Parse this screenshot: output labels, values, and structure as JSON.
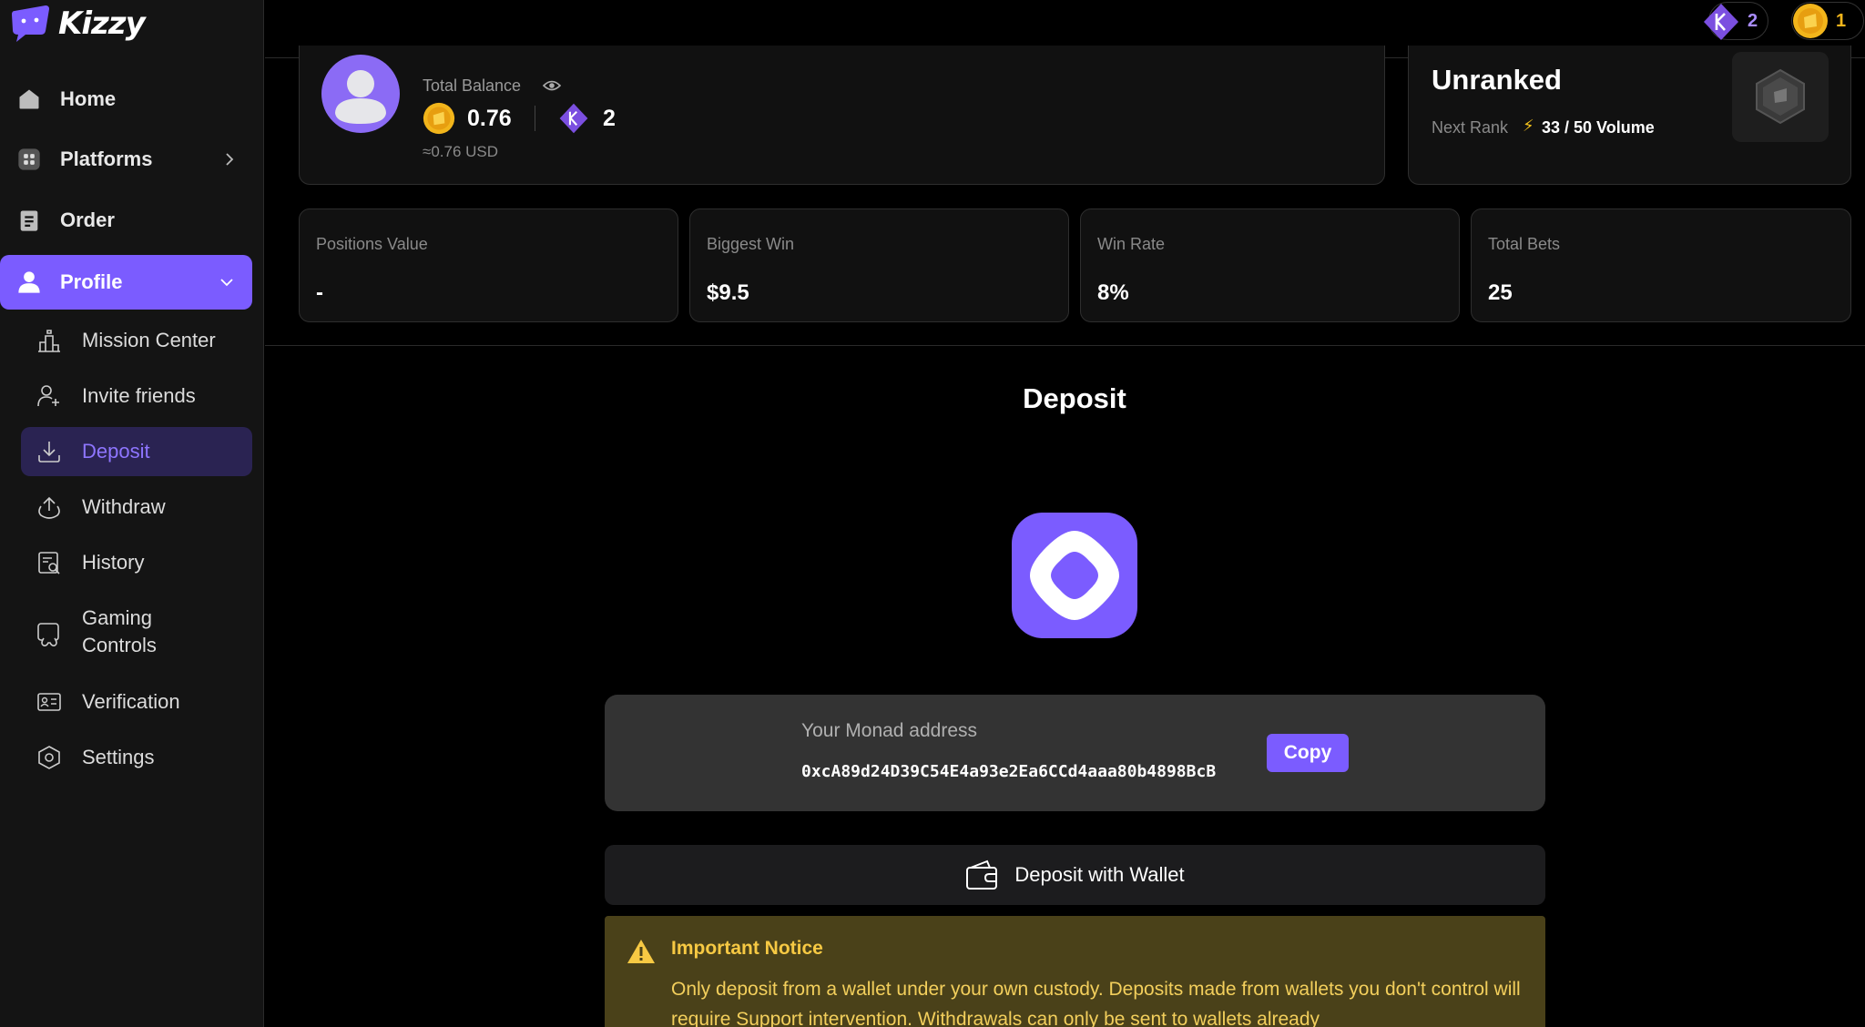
{
  "app": {
    "name": "Kizzy"
  },
  "topbar": {
    "k_count": "2",
    "coin_count": "1"
  },
  "sidebar": {
    "items": [
      {
        "label": "Home",
        "icon": "home-icon"
      },
      {
        "label": "Platforms",
        "icon": "grid-icon"
      },
      {
        "label": "Order",
        "icon": "clipboard-icon"
      },
      {
        "label": "Profile",
        "icon": "user-icon"
      }
    ],
    "sub_items": [
      {
        "label": "Mission Center",
        "icon": "podium-icon"
      },
      {
        "label": "Invite friends",
        "icon": "add-user-icon"
      },
      {
        "label": "Deposit",
        "icon": "download-icon"
      },
      {
        "label": "Withdraw",
        "icon": "upload-icon"
      },
      {
        "label": "History",
        "icon": "history-icon"
      },
      {
        "label": "Gaming Controls",
        "icon": "gamepad-icon"
      },
      {
        "label": "Verification",
        "icon": "id-card-icon"
      },
      {
        "label": "Settings",
        "icon": "settings-hex-icon"
      }
    ]
  },
  "balance": {
    "label": "Total Balance",
    "coin_value": "0.76",
    "k_value": "2",
    "usd": "≈0.76 USD"
  },
  "rank": {
    "title": "Unranked",
    "next_label": "Next Rank",
    "progress": "33 / 50 Volume",
    "progress_fraction": 0.66
  },
  "stats": [
    {
      "label": "Positions Value",
      "value": "-"
    },
    {
      "label": "Biggest Win",
      "value": "$9.5"
    },
    {
      "label": "Win Rate",
      "value": "8%"
    },
    {
      "label": "Total Bets",
      "value": "25"
    }
  ],
  "deposit": {
    "title": "Deposit",
    "address_label": "Your Monad address",
    "address": "0xcA89d24D39C54E4a93e2Ea6CCd4aaa80b4898BcB",
    "copy_label": "Copy",
    "wallet_label": "Deposit with Wallet"
  },
  "notice": {
    "title": "Important Notice",
    "text": "Only deposit from a wallet under your own custody. Deposits made from wallets you don't control will require Support intervention. Withdrawals can only be sent to wallets already"
  },
  "colors": {
    "accent": "#7b5cff",
    "gold": "#f2b51b",
    "notice_bg": "#4a4119",
    "notice_text": "#f3cf5c"
  }
}
